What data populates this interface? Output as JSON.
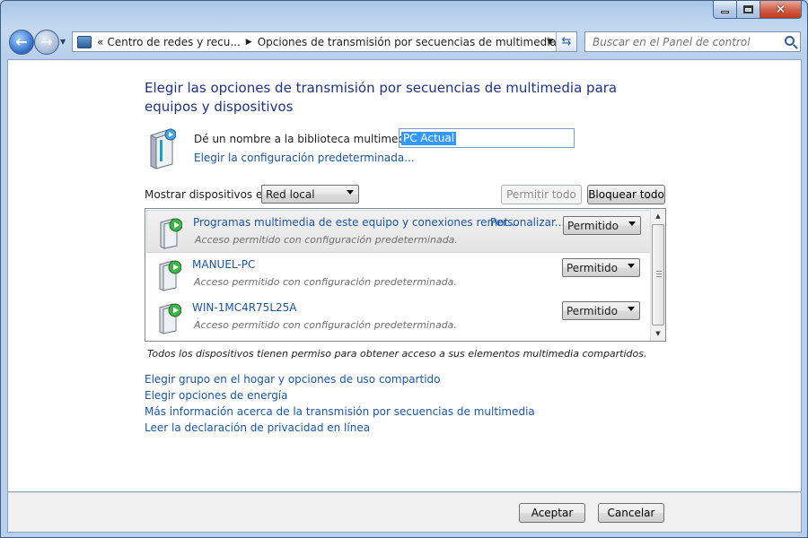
{
  "window": {
    "caption": {
      "minimize": "minimize",
      "maximize": "maximize",
      "close": "close"
    }
  },
  "navigation": {
    "back_icon": "back-arrow-icon",
    "forward_icon": "forward-arrow-icon",
    "breadcrumb": {
      "overflow": "«",
      "items": [
        "Centro de redes y recu...",
        "Opciones de transmisión por secuencias de multimedia"
      ]
    },
    "search_placeholder": "Buscar en el Panel de control"
  },
  "main": {
    "title": "Elegir las opciones de transmisión por secuencias de multimedia para equipos y dispositivos",
    "library": {
      "label": "Dé un nombre a la biblioteca multimedia:",
      "value": "PC Actual",
      "default_link": "Elegir la configuración predeterminada..."
    },
    "show_devices": {
      "label": "Mostrar dispositivos en:",
      "selected": "Red local"
    },
    "allow_all": "Permitir todo",
    "block_all": "Bloquear todo",
    "devices": [
      {
        "name": "Programas multimedia de este equipo y conexiones remot...",
        "customize": "Personalizar...",
        "status": "Acceso permitido con configuración predeterminada.",
        "permission": "Permitido",
        "selected": true
      },
      {
        "name": "MANUEL-PC",
        "status": "Acceso permitido con configuración predeterminada.",
        "permission": "Permitido",
        "selected": false
      },
      {
        "name": "WIN-1MC4R75L25A",
        "status": "Acceso permitido con configuración predeterminada.",
        "permission": "Permitido",
        "selected": false
      }
    ],
    "note": "Todos los dispositivos tienen permiso para obtener acceso a sus elementos multimedia compartidos.",
    "links": [
      "Elegir grupo en el hogar y opciones de uso compartido",
      "Elegir opciones de energía",
      "Más información acerca de la transmisión por secuencias de multimedia",
      "Leer la declaración de privacidad en línea"
    ]
  },
  "footer": {
    "ok": "Aceptar",
    "cancel": "Cancelar"
  },
  "colors": {
    "link": "#1a55a8",
    "title": "#1e3287",
    "selection": "#3399ff"
  }
}
